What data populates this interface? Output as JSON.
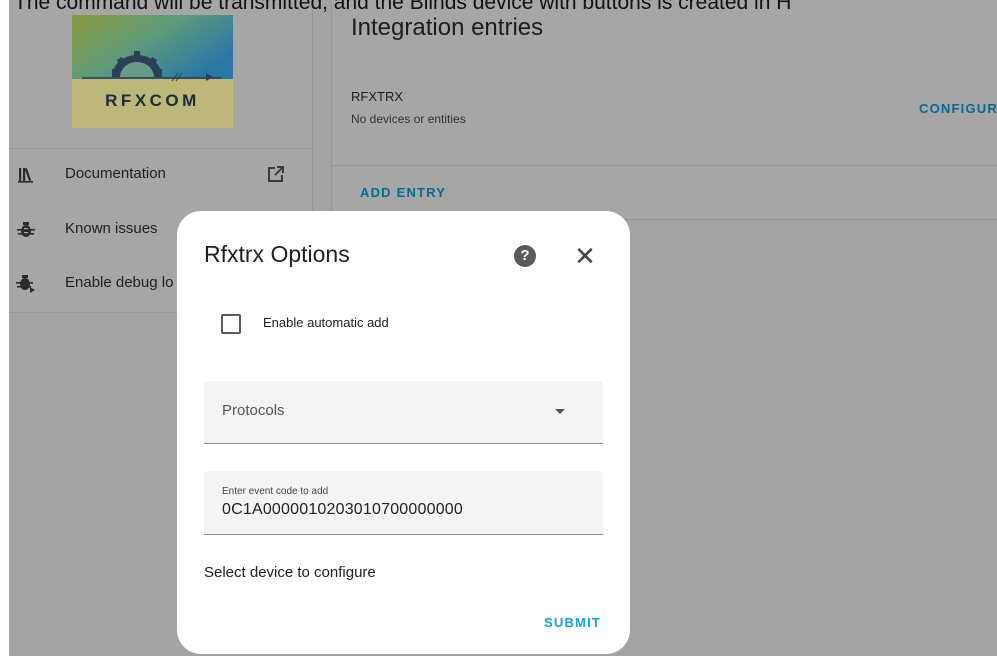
{
  "caption": "The command will be transmitted, and the Blinds device with buttons is created in H",
  "logo": {
    "text": "RFXCOM"
  },
  "menu": [
    {
      "label": "Documentation",
      "icon": "book-icon",
      "trailing_icon": "open-in-new-icon"
    },
    {
      "label": "Known issues",
      "icon": "bug-icon"
    },
    {
      "label": "Enable debug lo",
      "icon": "bug-play-icon"
    }
  ],
  "integrations": {
    "title": "Integration entries",
    "entry_name": "RFXTRX",
    "entry_subtitle": "No devices or entities",
    "configure_label": "CONFIGUR",
    "add_entry_label": "ADD ENTRY"
  },
  "dialog": {
    "title": "Rfxtrx Options",
    "help_icon": "help-circle-icon",
    "close_icon": "close-icon",
    "auto_add_label": "Enable automatic add",
    "auto_add_checked": false,
    "protocols_label": "Protocols",
    "event_code_label": "Enter event code to add",
    "event_code_value": "0C1A0000010203010700000000",
    "select_device_label": "Select device to configure",
    "submit_label": "SUBMIT"
  },
  "colors": {
    "overlay": "#a3a3a3",
    "accent": "#13a3dd",
    "accent_dimmed": "#056a93",
    "dialog_bg": "#ffffff"
  }
}
